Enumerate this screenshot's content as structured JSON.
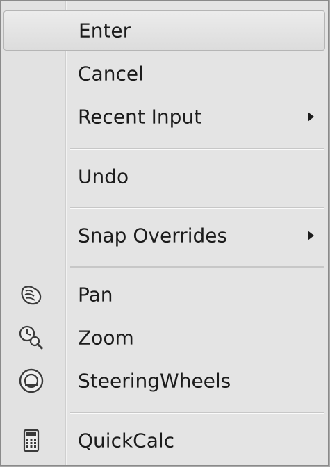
{
  "menu": {
    "items": [
      {
        "label": "Enter",
        "icon": null,
        "submenu": false,
        "highlighted": true
      },
      {
        "label": "Cancel",
        "icon": null,
        "submenu": false
      },
      {
        "label": "Recent Input",
        "icon": null,
        "submenu": true
      },
      {
        "label": "Undo",
        "icon": null,
        "submenu": false
      },
      {
        "label": "Snap Overrides",
        "icon": null,
        "submenu": true
      },
      {
        "label": "Pan",
        "icon": "pan-hand-icon",
        "submenu": false
      },
      {
        "label": "Zoom",
        "icon": "zoom-clock-magnifier-icon",
        "submenu": false
      },
      {
        "label": "SteeringWheels",
        "icon": "steering-wheel-icon",
        "submenu": false
      },
      {
        "label": "QuickCalc",
        "icon": "calculator-icon",
        "submenu": false
      }
    ]
  },
  "colors": {
    "menu_background": "#e4e4e4",
    "highlight_background": "#e0e0e0",
    "separator": "#c7c7c7",
    "text": "#1c1c1c"
  }
}
